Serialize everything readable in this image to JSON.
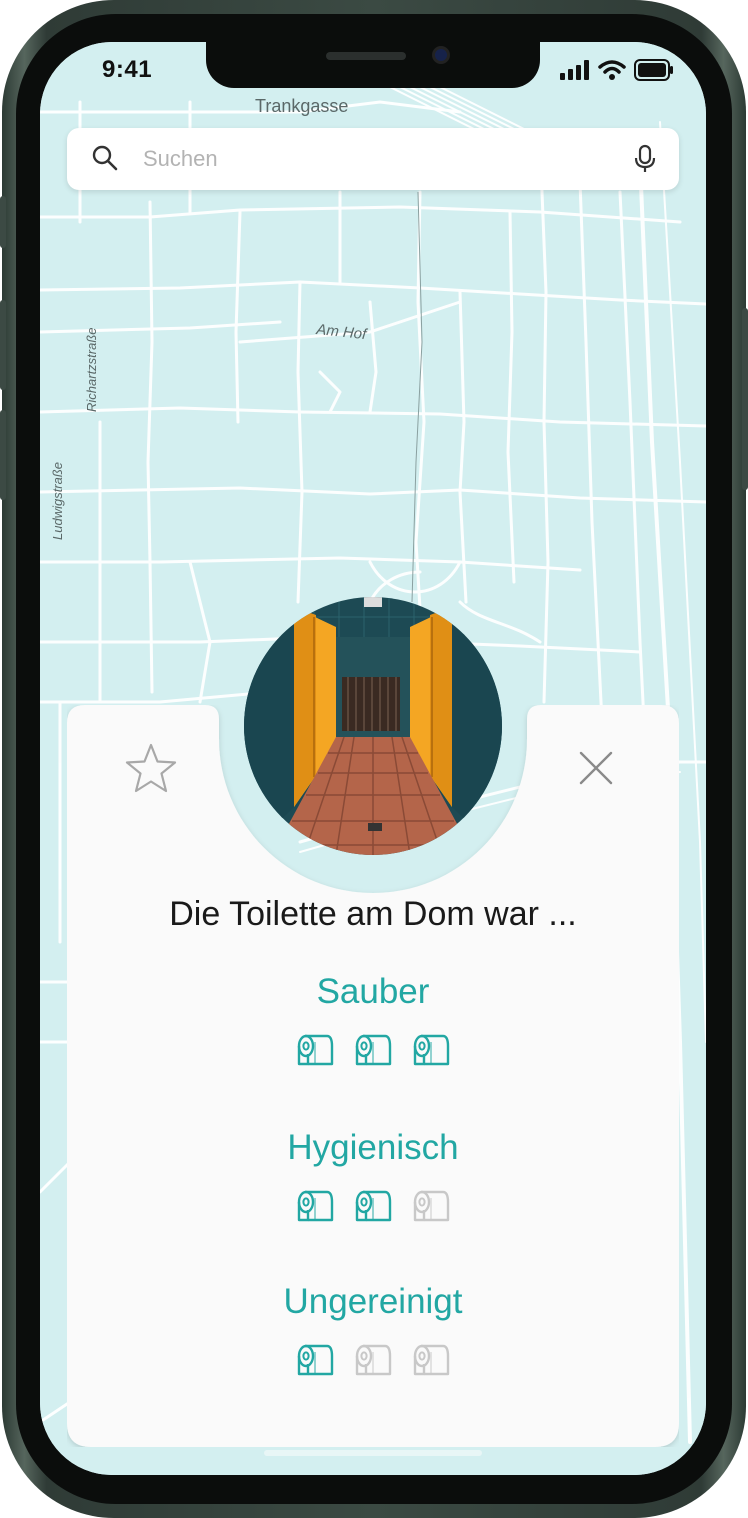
{
  "status_bar": {
    "time": "9:41"
  },
  "map": {
    "labels": {
      "trankgasse": "Trankgasse",
      "am_hof": "Am Hof",
      "richartzstrasse": "Richartzstraße",
      "ludwigstrasse": "Ludwigstraße"
    }
  },
  "search": {
    "placeholder": "Suchen"
  },
  "card": {
    "title": "Die Toilette am Dom war ...",
    "ratings": [
      {
        "label": "Sauber",
        "score": 3,
        "max": 3
      },
      {
        "label": "Hygienisch",
        "score": 2,
        "max": 3
      },
      {
        "label": "Ungereinigt",
        "score": 1,
        "max": 3
      }
    ]
  },
  "colors": {
    "accent": "#22a7a3",
    "inactive": "#c8c8c8",
    "map_bg": "#d3eff0",
    "map_road": "#ffffff"
  },
  "icons": [
    "search-icon",
    "microphone-icon",
    "star-icon",
    "close-icon",
    "toilet-paper-icon",
    "signal-icon",
    "wifi-icon",
    "battery-icon"
  ]
}
